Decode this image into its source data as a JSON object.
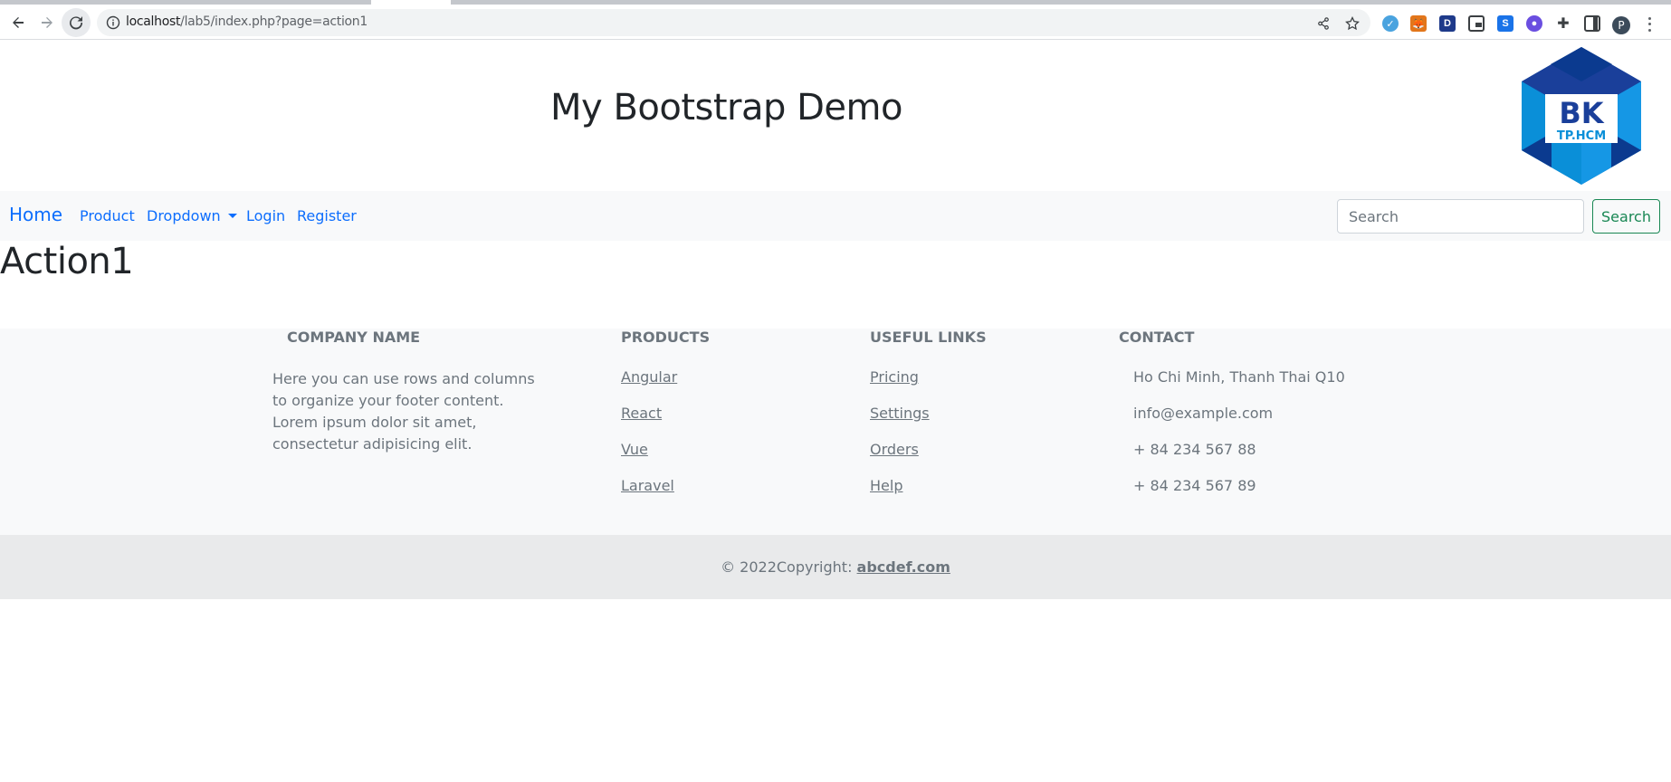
{
  "browser": {
    "url_host": "localhost",
    "url_path": "/lab5/index.php?page=action1",
    "profile_initial": "P"
  },
  "header": {
    "title": "My Bootstrap Demo",
    "logo_text": "BK",
    "logo_subtext": "TP.HCM"
  },
  "navbar": {
    "brand": "Home",
    "links": [
      "Product",
      "Dropdown",
      "Login",
      "Register"
    ],
    "search_placeholder": "Search",
    "search_button": "Search"
  },
  "main": {
    "heading": "Action1"
  },
  "footer": {
    "company": {
      "title": "Company name",
      "text": "Here you can use rows and columns to organize your footer content. Lorem ipsum dolor sit amet, consectetur adipisicing elit."
    },
    "products": {
      "title": "Products",
      "items": [
        "Angular",
        "React",
        "Vue",
        "Laravel"
      ]
    },
    "useful_links": {
      "title": "Useful links",
      "items": [
        "Pricing",
        "Settings",
        "Orders",
        "Help"
      ]
    },
    "contact": {
      "title": "Contact",
      "items": [
        "Ho Chi Minh, Thanh Thai Q10",
        "info@example.com",
        "+ 84 234 567 88",
        "+ 84 234 567 89"
      ]
    }
  },
  "copyright": {
    "prefix": "© 2022Copyright: ",
    "link": "abcdef.com"
  },
  "colors": {
    "primary": "#0d6efd",
    "success": "#198754",
    "muted": "#6c757d",
    "footer_bg": "#f8f9fa"
  }
}
